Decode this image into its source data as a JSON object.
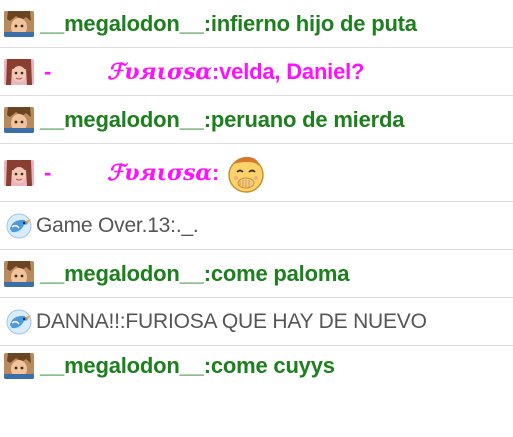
{
  "icons": {
    "megalodon_avatar": "brown-haired-avatar-icon",
    "furiosa_avatar": "pink-avatar-icon",
    "guest_avatar": "blue-bird-icon",
    "emoji": "laughing-emoji-icon"
  },
  "colors": {
    "megalodon": "#1d7f1d",
    "furiosa": "#ff10ff",
    "guest": "#555555",
    "divider": "#dcdcdc"
  },
  "messages": [
    {
      "user": "__megalodon__",
      "sep": ": ",
      "text": "infierno hijo de puta"
    },
    {
      "prefix": "-",
      "user": "ℱυяισѕα",
      "sep": ": ",
      "text": "velda, Daniel?"
    },
    {
      "user": "__megalodon__",
      "sep": ": ",
      "text": "peruano de mierda"
    },
    {
      "prefix": "-",
      "user": "ℱυяισѕα",
      "sep": ": ",
      "text": ""
    },
    {
      "user": "Game Over.13",
      "sep": ": ",
      "text": "._."
    },
    {
      "user": "__megalodon__",
      "sep": ": ",
      "text": "come paloma"
    },
    {
      "user": "DANNA!!",
      "sep": ": ",
      "text": "FURIOSA QUE HAY DE NUEVO"
    },
    {
      "user": "__megalodon__",
      "sep": ": ",
      "text": "come cuyys"
    }
  ]
}
